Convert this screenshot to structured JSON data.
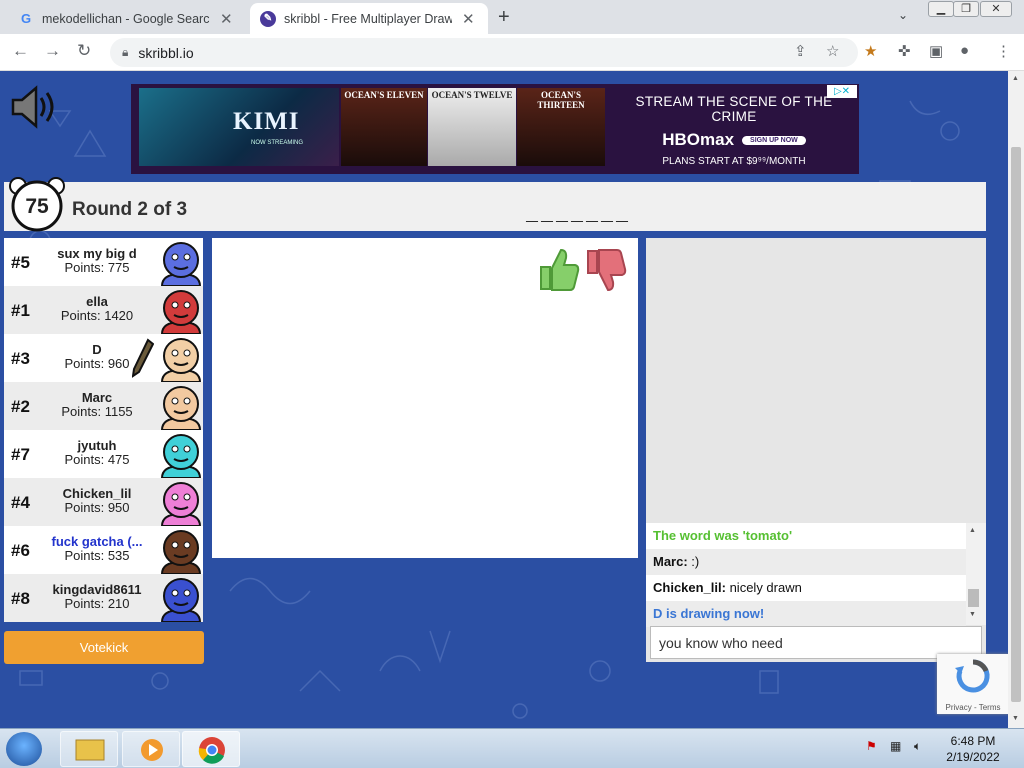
{
  "browser": {
    "tabs": [
      {
        "title": "mekodellichan - Google Search",
        "favicon": "G"
      },
      {
        "title": "skribbl - Free Multiplayer Drawing",
        "favicon": "✎"
      }
    ],
    "new_tab": "+",
    "url": "skribbl.io"
  },
  "ad": {
    "movie": "KIMI",
    "movie_sub": "NOW STREAMING",
    "posters": [
      "OCEAN'S ELEVEN",
      "OCEAN'S TWELVE",
      "OCEAN'S THIRTEEN"
    ],
    "headline": "STREAM THE SCENE OF THE CRIME",
    "brand": "HBOmax",
    "cta": "SIGN UP NOW",
    "price": "PLANS START AT $9⁹⁹/MONTH"
  },
  "game": {
    "timer": "75",
    "round": "Round 2 of 3",
    "word_hint": "_______"
  },
  "players": [
    {
      "rank": "#5",
      "name": "sux my big d",
      "points": "Points: 775",
      "color": "#5b6ee0",
      "drawing": false,
      "blue": false
    },
    {
      "rank": "#1",
      "name": "ella",
      "points": "Points: 1420",
      "color": "#d23b3b",
      "drawing": false,
      "blue": false
    },
    {
      "rank": "#3",
      "name": "D",
      "points": "Points: 960",
      "color": "#f2cfa6",
      "drawing": true,
      "blue": false
    },
    {
      "rank": "#2",
      "name": "Marc",
      "points": "Points: 1155",
      "color": "#f2c9a0",
      "drawing": false,
      "blue": false
    },
    {
      "rank": "#7",
      "name": "jyutuh",
      "points": "Points: 475",
      "color": "#40d0d8",
      "drawing": false,
      "blue": false
    },
    {
      "rank": "#4",
      "name": "Chicken_lil",
      "points": "Points: 950",
      "color": "#ee7fd6",
      "drawing": false,
      "blue": false
    },
    {
      "rank": "#6",
      "name": "fuck gatcha (...",
      "points": "Points: 535",
      "color": "#6a3b22",
      "drawing": false,
      "blue": true
    },
    {
      "rank": "#8",
      "name": "kingdavid8611",
      "points": "Points: 210",
      "color": "#3a50d0",
      "drawing": false,
      "blue": false
    }
  ],
  "votekick": "Votekick",
  "chat": {
    "messages": [
      {
        "name": "",
        "text": "The word was 'tomato'",
        "style": "green"
      },
      {
        "name": "Marc:",
        "text": " :)",
        "style": "normal"
      },
      {
        "name": "Chicken_lil:",
        "text": " nicely drawn",
        "style": "normal"
      },
      {
        "name": "",
        "text": "D is drawing now!",
        "style": "blue"
      }
    ],
    "input_value": "you know who need"
  },
  "recaptcha": {
    "terms": "Privacy - Terms"
  },
  "taskbar": {
    "time": "6:48 PM",
    "date": "2/19/2022"
  }
}
